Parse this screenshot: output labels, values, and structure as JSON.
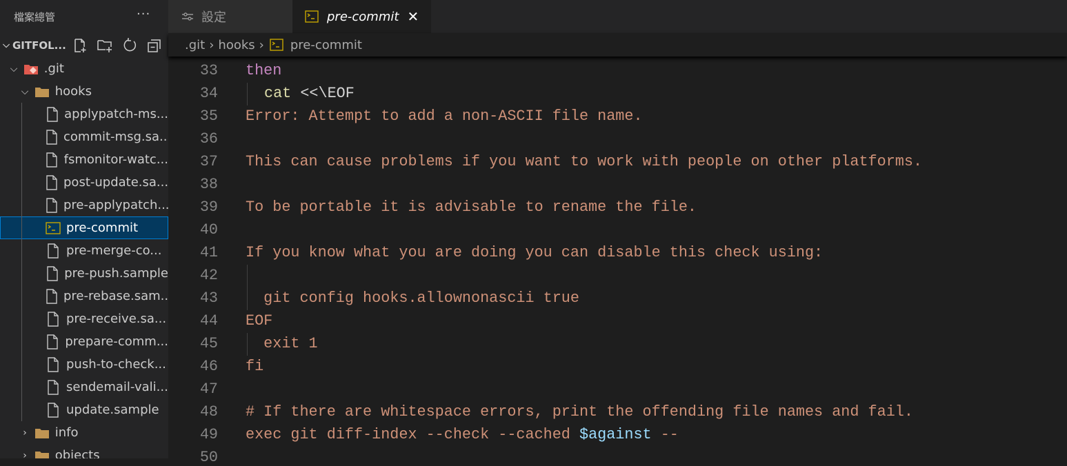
{
  "sidebar": {
    "title": "檔案總管",
    "more_label": "···",
    "root": "GITFOL...",
    "tree": [
      {
        "label": ".git",
        "depth": 0,
        "type": "git-folder",
        "expanded": true
      },
      {
        "label": "hooks",
        "depth": 1,
        "type": "folder-open",
        "expanded": true
      },
      {
        "label": "applypatch-ms...",
        "depth": 2,
        "type": "file"
      },
      {
        "label": "commit-msg.sa...",
        "depth": 2,
        "type": "file"
      },
      {
        "label": "fsmonitor-watc...",
        "depth": 2,
        "type": "file"
      },
      {
        "label": "post-update.sa...",
        "depth": 2,
        "type": "file"
      },
      {
        "label": "pre-applypatch...",
        "depth": 2,
        "type": "file"
      },
      {
        "label": "pre-commit",
        "depth": 2,
        "type": "shell",
        "selected": true
      },
      {
        "label": "pre-merge-co...",
        "depth": 2,
        "type": "file"
      },
      {
        "label": "pre-push.sample",
        "depth": 2,
        "type": "file"
      },
      {
        "label": "pre-rebase.sam...",
        "depth": 2,
        "type": "file"
      },
      {
        "label": "pre-receive.sa...",
        "depth": 2,
        "type": "file"
      },
      {
        "label": "prepare-comm...",
        "depth": 2,
        "type": "file"
      },
      {
        "label": "push-to-check...",
        "depth": 2,
        "type": "file"
      },
      {
        "label": "sendemail-vali...",
        "depth": 2,
        "type": "file"
      },
      {
        "label": "update.sample",
        "depth": 2,
        "type": "file"
      },
      {
        "label": "info",
        "depth": 1,
        "type": "folder",
        "expanded": false
      },
      {
        "label": "objects",
        "depth": 1,
        "type": "folder",
        "expanded": false
      }
    ]
  },
  "tabs": [
    {
      "label": "設定",
      "icon": "settings-sliders-icon"
    },
    {
      "label": "pre-commit",
      "icon": "shell-icon",
      "active": true,
      "close": "✕"
    }
  ],
  "breadcrumb": [
    ".git",
    "hooks",
    "pre-commit"
  ],
  "editor": {
    "lines": [
      {
        "n": 33,
        "indent": 0,
        "seg": [
          [
            "then",
            "kw"
          ]
        ]
      },
      {
        "n": 34,
        "indent": 1,
        "seg": [
          [
            "cat ",
            "fn"
          ],
          [
            "<<\\EOF",
            "plain"
          ]
        ]
      },
      {
        "n": 35,
        "indent": 0,
        "seg": [
          [
            "Error: Attempt to add a non-ASCII file name.",
            "str"
          ]
        ]
      },
      {
        "n": 36,
        "indent": 0,
        "seg": []
      },
      {
        "n": 37,
        "indent": 0,
        "seg": [
          [
            "This can cause problems if you want to work with people on other platforms.",
            "str"
          ]
        ]
      },
      {
        "n": 38,
        "indent": 0,
        "seg": []
      },
      {
        "n": 39,
        "indent": 0,
        "seg": [
          [
            "To be portable it is advisable to rename the file.",
            "str"
          ]
        ]
      },
      {
        "n": 40,
        "indent": 0,
        "seg": []
      },
      {
        "n": 41,
        "indent": 0,
        "seg": [
          [
            "If you know what you are doing you can disable this check using:",
            "str"
          ]
        ]
      },
      {
        "n": 42,
        "indent": 1,
        "seg": []
      },
      {
        "n": 43,
        "indent": 1,
        "seg": [
          [
            "  git config hooks.allownonascii true",
            "str"
          ]
        ]
      },
      {
        "n": 44,
        "indent": 0,
        "seg": [
          [
            "EOF",
            "str"
          ]
        ]
      },
      {
        "n": 45,
        "indent": 1,
        "seg": [
          [
            "  exit 1",
            "str"
          ]
        ]
      },
      {
        "n": 46,
        "indent": 0,
        "seg": [
          [
            "fi",
            "str"
          ]
        ]
      },
      {
        "n": 47,
        "indent": 0,
        "seg": []
      },
      {
        "n": 48,
        "indent": 0,
        "seg": [
          [
            "# If there are whitespace errors, print the offending file names and fail.",
            "str"
          ]
        ]
      },
      {
        "n": 49,
        "indent": 0,
        "seg": [
          [
            "exec git diff-index --check --cached ",
            "str"
          ],
          [
            "$against",
            "var"
          ],
          [
            " --",
            "str"
          ]
        ]
      },
      {
        "n": 50,
        "indent": 0,
        "seg": []
      }
    ]
  },
  "colors": {
    "selection": "#04395e",
    "focus_border": "#007fd4",
    "keyword": "#c586c0",
    "function": "#dcdcaa",
    "string": "#ce9178",
    "variable": "#9cdcfe"
  }
}
